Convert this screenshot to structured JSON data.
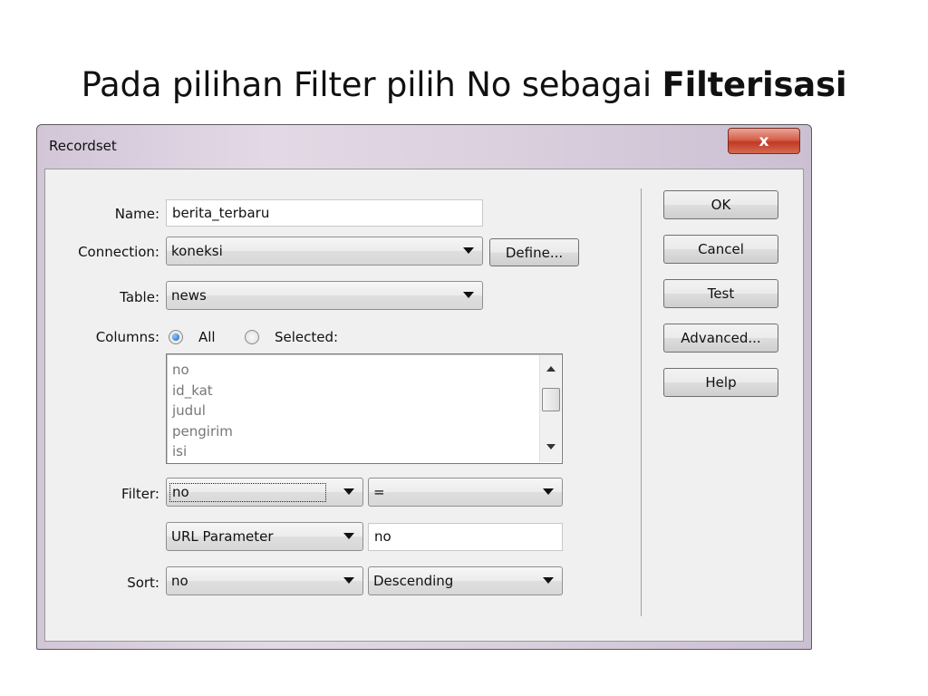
{
  "slide": {
    "title_normal": "Pada pilihan Filter pilih No sebagai ",
    "title_bold": "Filterisasi"
  },
  "dialog": {
    "title": "Recordset",
    "close_glyph": "x",
    "labels": {
      "name": "Name:",
      "connection": "Connection:",
      "table": "Table:",
      "columns": "Columns:",
      "filter": "Filter:",
      "sort": "Sort:"
    },
    "name_value": "berita_terbaru",
    "connection_value": "koneksi",
    "define_label": "Define...",
    "table_value": "news",
    "columns_all_label": "All",
    "columns_selected_label": "Selected:",
    "columns_mode": "All",
    "columns_list": [
      "no",
      "id_kat",
      "judul",
      "pengirim",
      "isi"
    ],
    "filter_column": "no",
    "filter_operator": "=",
    "filter_source": "URL Parameter",
    "filter_value": "no",
    "sort_column": "no",
    "sort_order": "Descending",
    "buttons": {
      "ok": "OK",
      "cancel": "Cancel",
      "test": "Test",
      "advanced": "Advanced...",
      "help": "Help"
    }
  }
}
